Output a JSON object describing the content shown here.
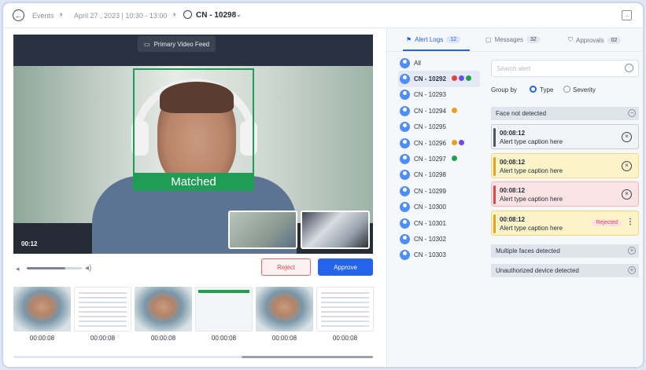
{
  "header": {
    "crumb_events": "Events",
    "crumb_date": "April 27 , 2023 | 10:30 - 13:00",
    "candidate": "CN - 10298"
  },
  "video": {
    "feed_label": "Primary Video Feed",
    "match_label": "Matched",
    "timestamp": "00:12",
    "volume_level": 0.7
  },
  "actions": {
    "reject": "Reject",
    "approve": "Approve"
  },
  "thumbnails": [
    {
      "time": "00:00:08",
      "kind": "face"
    },
    {
      "time": "00:00:08",
      "kind": "doc"
    },
    {
      "time": "00:00:08",
      "kind": "face"
    },
    {
      "time": "00:00:08",
      "kind": "panel"
    },
    {
      "time": "00:00:08",
      "kind": "face"
    },
    {
      "time": "00:00:08",
      "kind": "doc"
    }
  ],
  "tabs": [
    {
      "label": "Alert Logs",
      "count": "12",
      "icon": "flag-icon"
    },
    {
      "label": "Messages",
      "count": "32",
      "icon": "chat-icon"
    },
    {
      "label": "Approvals",
      "count": "02",
      "icon": "shield-icon"
    }
  ],
  "candidates": [
    {
      "label": "All",
      "dots": []
    },
    {
      "label": "CN - 10292",
      "dots": [
        "#e0453a",
        "#6b4de6",
        "#19a34a"
      ],
      "selected": true
    },
    {
      "label": "CN - 10293",
      "dots": []
    },
    {
      "label": "CN - 10294",
      "dots": [
        "#e8a020"
      ]
    },
    {
      "label": "CN - 10295",
      "dots": []
    },
    {
      "label": "CN - 10296",
      "dots": [
        "#e8a020",
        "#6b4de6"
      ]
    },
    {
      "label": "CN - 10297",
      "dots": [
        "#19a34a"
      ]
    },
    {
      "label": "CN - 10298",
      "dots": []
    },
    {
      "label": "CN - 10299",
      "dots": []
    },
    {
      "label": "CN - 10300",
      "dots": []
    },
    {
      "label": "CN - 10301",
      "dots": []
    },
    {
      "label": "CN - 10302",
      "dots": []
    },
    {
      "label": "CN - 10303",
      "dots": []
    }
  ],
  "alerts": {
    "search_placeholder": "Search alert",
    "group_by": "Group by",
    "opt_type": "Type",
    "opt_severity": "Severity",
    "sections": {
      "face": "Face not detected",
      "multi": "Multiple faces detected",
      "device": "Unauthorized device detected"
    },
    "cards": [
      {
        "time": "00:08:12",
        "caption": "Alert type caption here",
        "bg": "#f1f3f6",
        "side": "#4b5563",
        "border": "#c7ccd5"
      },
      {
        "time": "00:08:12",
        "caption": "Alert type caption here",
        "bg": "#fdf3c9",
        "side": "#e8a020",
        "border": "#f0d98a"
      },
      {
        "time": "00:08:12",
        "caption": "Alert type caption here",
        "bg": "#fde4e4",
        "side": "#d84a4a",
        "border": "#f2b8b8"
      },
      {
        "time": "00:08:12",
        "caption": "Alert type caption here",
        "bg": "#fdf3c9",
        "side": "#e8a020",
        "border": "#f0d98a",
        "status": "Rejected"
      }
    ]
  },
  "colors": {
    "accent": "#2563eb",
    "match": "#1f9d55",
    "reject": "#d84a4a"
  }
}
